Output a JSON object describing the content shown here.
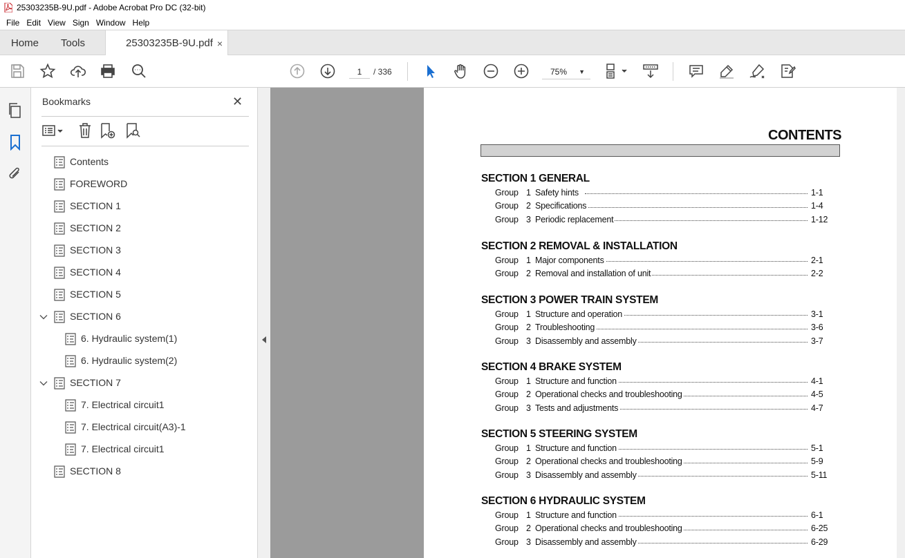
{
  "window": {
    "title": "25303235B-9U.pdf - Adobe Acrobat Pro DC (32-bit)"
  },
  "menu": [
    "File",
    "Edit",
    "View",
    "Sign",
    "Window",
    "Help"
  ],
  "tabs": {
    "home": "Home",
    "tools": "Tools",
    "document": "25303235B-9U.pdf",
    "close_glyph": "×"
  },
  "toolbar": {
    "page_current": "1",
    "page_total": "/  336",
    "zoom": "75%"
  },
  "bookmarks": {
    "title": "Bookmarks",
    "close_glyph": "✕",
    "items": [
      {
        "label": "Contents",
        "level": 0,
        "expanded": null
      },
      {
        "label": "FOREWORD",
        "level": 0,
        "expanded": null
      },
      {
        "label": "SECTION 1",
        "level": 0,
        "expanded": null
      },
      {
        "label": "SECTION 2",
        "level": 0,
        "expanded": null
      },
      {
        "label": "SECTION 3",
        "level": 0,
        "expanded": null
      },
      {
        "label": "SECTION 4",
        "level": 0,
        "expanded": null
      },
      {
        "label": "SECTION 5",
        "level": 0,
        "expanded": null
      },
      {
        "label": "SECTION 6",
        "level": 0,
        "expanded": true
      },
      {
        "label": "6. Hydraulic system(1)",
        "level": 1,
        "expanded": null
      },
      {
        "label": "6. Hydraulic system(2)",
        "level": 1,
        "expanded": null
      },
      {
        "label": "SECTION 7",
        "level": 0,
        "expanded": true
      },
      {
        "label": "7. Electrical circuit1",
        "level": 1,
        "expanded": null
      },
      {
        "label": "7. Electrical circuit(A3)-1",
        "level": 1,
        "expanded": null
      },
      {
        "label": "7. Electrical circuit1",
        "level": 1,
        "expanded": null
      },
      {
        "label": "SECTION 8",
        "level": 0,
        "expanded": null
      }
    ]
  },
  "document": {
    "title": "CONTENTS",
    "sections": [
      {
        "heading": "SECTION  1  GENERAL",
        "groups": [
          {
            "label": "Group",
            "num": "1",
            "name": "Safety hints",
            "page": "1-1"
          },
          {
            "label": "Group",
            "num": "2",
            "name": "Specifications",
            "page": "1-4"
          },
          {
            "label": "Group",
            "num": "3",
            "name": "Periodic replacement",
            "page": "1-12"
          }
        ]
      },
      {
        "heading": "SECTION  2  REMOVAL & INSTALLATION",
        "groups": [
          {
            "label": "Group",
            "num": "1",
            "name": "Major components",
            "page": "2-1"
          },
          {
            "label": "Group",
            "num": "2",
            "name": "Removal and installation of unit",
            "page": "2-2"
          }
        ]
      },
      {
        "heading": "SECTION  3  POWER TRAIN SYSTEM",
        "groups": [
          {
            "label": "Group",
            "num": "1",
            "name": "Structure and operation",
            "page": "3-1"
          },
          {
            "label": "Group",
            "num": "2",
            "name": "Troubleshooting",
            "page": "3-6"
          },
          {
            "label": "Group",
            "num": "3",
            "name": "Disassembly and assembly",
            "page": "3-7"
          }
        ]
      },
      {
        "heading": "SECTION  4  BRAKE SYSTEM",
        "groups": [
          {
            "label": "Group",
            "num": "1",
            "name": "Structure and function",
            "page": "4-1"
          },
          {
            "label": "Group",
            "num": "2",
            "name": "Operational checks and troubleshooting",
            "page": "4-5"
          },
          {
            "label": "Group",
            "num": "3",
            "name": "Tests and adjustments",
            "page": "4-7"
          }
        ]
      },
      {
        "heading": "SECTION  5  STEERING SYSTEM",
        "groups": [
          {
            "label": "Group",
            "num": "1",
            "name": "Structure and function",
            "page": "5-1"
          },
          {
            "label": "Group",
            "num": "2",
            "name": "Operational checks and troubleshooting",
            "page": "5-9"
          },
          {
            "label": "Group",
            "num": "3",
            "name": "Disassembly and assembly",
            "page": "5-11"
          }
        ]
      },
      {
        "heading": "SECTION  6  HYDRAULIC SYSTEM",
        "groups": [
          {
            "label": "Group",
            "num": "1",
            "name": "Structure and function",
            "page": "6-1"
          },
          {
            "label": "Group",
            "num": "2",
            "name": "Operational checks and troubleshooting",
            "page": "6-25"
          },
          {
            "label": "Group",
            "num": "3",
            "name": "Disassembly and assembly",
            "page": "6-29"
          }
        ]
      }
    ]
  }
}
